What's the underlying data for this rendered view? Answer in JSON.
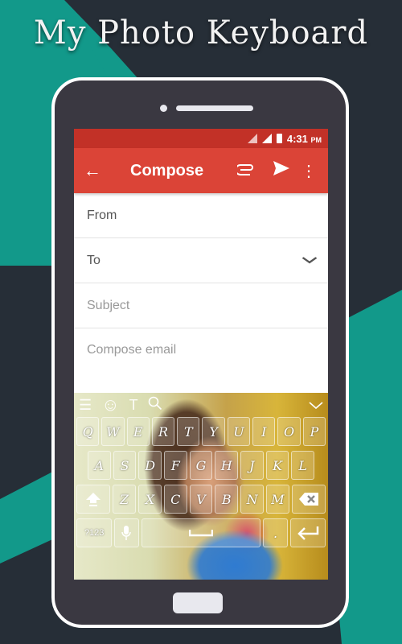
{
  "banner": {
    "title": "My Photo Keyboard"
  },
  "status_bar": {
    "time": "4:31",
    "ampm": "PM"
  },
  "toolbar": {
    "back_icon": "←",
    "title": "Compose",
    "attach_icon": "📎",
    "send_icon": "➤",
    "more_icon": "⋮"
  },
  "form": {
    "from_label": "From",
    "to_label": "To",
    "to_expand_icon": "⌄",
    "subject_placeholder": "Subject",
    "body_placeholder": "Compose email"
  },
  "keyboard": {
    "toolbar": {
      "menu_icon": "☰",
      "emoji_icon": "☺",
      "text_icon": "T",
      "search_icon": "⚲",
      "hide_icon": "⌄"
    },
    "row1": [
      "Q",
      "W",
      "E",
      "R",
      "T",
      "Y",
      "U",
      "I",
      "O",
      "P"
    ],
    "row2": [
      "A",
      "S",
      "D",
      "F",
      "G",
      "H",
      "J",
      "K",
      "L"
    ],
    "row3": [
      "Z",
      "X",
      "C",
      "V",
      "B",
      "N",
      "M"
    ],
    "shift_icon": "⇧",
    "backspace_icon": "⌫",
    "symbols_label": "?123",
    "mic_icon": "🎤",
    "space_icon": "␣",
    "period_label": ".",
    "enter_icon": "↵"
  },
  "colors": {
    "accent_red": "#db4437",
    "status_red": "#c23127",
    "teal": "#12998a",
    "background": "#262e37"
  }
}
